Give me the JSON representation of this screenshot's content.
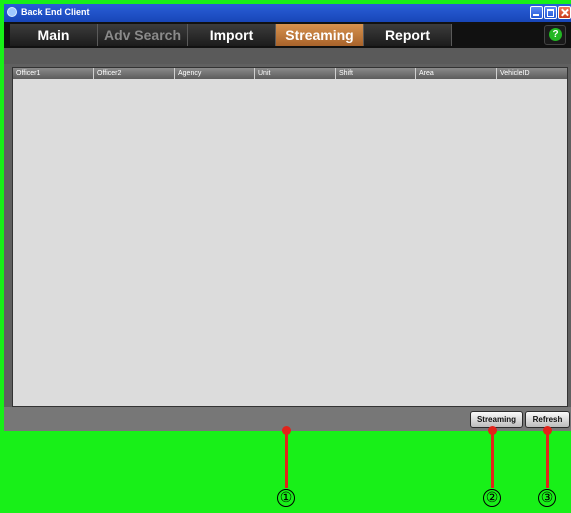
{
  "window": {
    "title": "Back End Client"
  },
  "menu": {
    "tabs": [
      {
        "label": "Main",
        "state": "normal"
      },
      {
        "label": "Adv Search",
        "state": "disabled"
      },
      {
        "label": "Import",
        "state": "normal"
      },
      {
        "label": "Streaming",
        "state": "active"
      },
      {
        "label": "Report",
        "state": "normal"
      }
    ],
    "help_label": "?"
  },
  "table": {
    "columns": [
      "Officer1",
      "Officer2",
      "Agency",
      "Unit",
      "Shift",
      "Area",
      "VehicleID"
    ],
    "rows": []
  },
  "buttons": {
    "streaming": "Streaming",
    "refresh": "Refresh"
  },
  "callouts": [
    "①",
    "②",
    "③"
  ],
  "colors": {
    "background": "#18f018",
    "active_tab": "#c27a3c",
    "callout": "#e2231a"
  }
}
